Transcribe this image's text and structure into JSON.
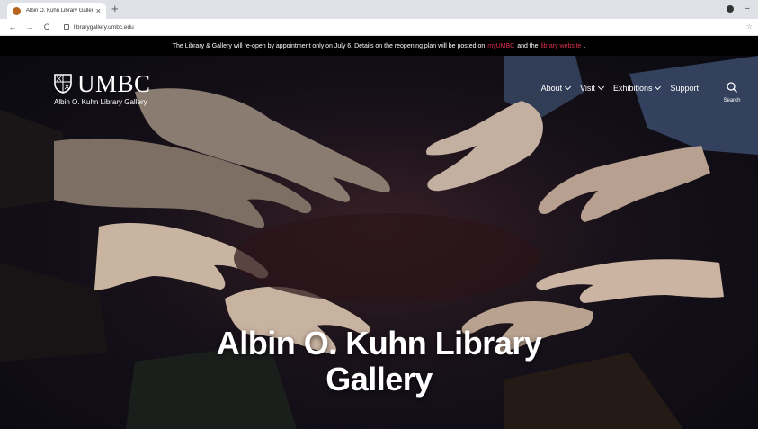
{
  "browser": {
    "tab_title": "Albin O. Kuhn Library Gallery",
    "tab_close": "×",
    "new_tab": "+",
    "back": "←",
    "forward": "→",
    "reload": "C",
    "url": "librarygallery.umbc.edu",
    "minimize": "–",
    "bookmark": "☆"
  },
  "notice": {
    "text_before": "The Library & Gallery will re-open by appointment only on July 6. Details on the reopening plan will be posted on",
    "link1": "myUMBC",
    "text_middle": "and the",
    "link2": "library website",
    "text_after": ".",
    "link_color": "#e0304e"
  },
  "header": {
    "brand": "UMBC",
    "subtitle": "Albin O. Kuhn Library Gallery",
    "nav": [
      {
        "label": "About"
      },
      {
        "label": "Visit"
      },
      {
        "label": "Exhibitions"
      },
      {
        "label": "Support"
      }
    ],
    "search_label": "Search"
  },
  "hero": {
    "title_line1": "Albin O. Kuhn Library",
    "title_line2": "Gallery"
  }
}
